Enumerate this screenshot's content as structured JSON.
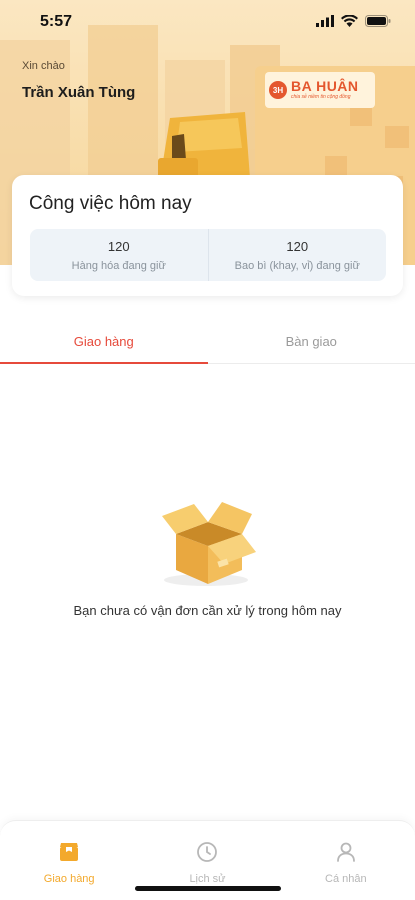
{
  "status_bar": {
    "time": "5:57"
  },
  "header": {
    "greeting": "Xin chào",
    "user_name": "Trần Xuân Tùng",
    "brand": {
      "logo_text": "3H",
      "name": "BA HUÂN",
      "slogan": "chia sẻ niềm tin cộng đồng"
    }
  },
  "work_card": {
    "title": "Công việc hôm nay",
    "stats": [
      {
        "value": "120",
        "label": "Hàng hóa đang giữ"
      },
      {
        "value": "120",
        "label": "Bao bì (khay, vỉ) đang giữ"
      }
    ]
  },
  "tabs": [
    {
      "label": "Giao hàng",
      "active": true
    },
    {
      "label": "Bàn giao",
      "active": false
    }
  ],
  "empty_state": {
    "icon": "open-box-icon",
    "message": "Bạn chưa có vận đơn cần xử lý trong hôm nay"
  },
  "bottom_nav": [
    {
      "label": "Giao hàng",
      "icon": "delivery-box-icon",
      "active": true
    },
    {
      "label": "Lịch sử",
      "icon": "clock-icon",
      "active": false
    },
    {
      "label": "Cá nhân",
      "icon": "user-icon",
      "active": false
    }
  ],
  "colors": {
    "accent": "#e64a3b",
    "nav_active": "#f3a92c",
    "brand": "#e4572e"
  }
}
